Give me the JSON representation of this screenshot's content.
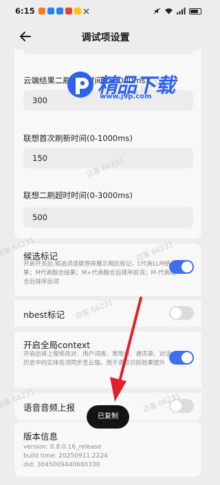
{
  "status_bar": {
    "time": "6:15",
    "battery": "75"
  },
  "nav": {
    "title": "调试项设置"
  },
  "fields": [
    {
      "label": "云端结果二刷超时时间(0-3000ms)",
      "value": "300"
    },
    {
      "label": "联想首次刷新时间(0-1000ms)",
      "value": "150"
    },
    {
      "label": "联想二刷超时时间(0-3000ms)",
      "value": "500"
    }
  ],
  "toggles": [
    {
      "title": "候选标记",
      "desc": "开启开关后,候选词语联想将展示相应标记，L代表LLM结果；M代表融合结果；M+代表融合后排序前词；M-代表融合后排序后词",
      "on": true
    },
    {
      "title": "nbest标记",
      "desc": "",
      "on": false
    },
    {
      "title": "开启全局context",
      "desc": "开启后将上报修改对、用户词库、常用语、通讯录、对话历史中的实体名词同步至云端，用于语音识别效果提升",
      "on": true
    },
    {
      "title": "语音音频上报",
      "desc": "",
      "on": false
    }
  ],
  "version_info": {
    "title": "版本信息",
    "version": "version: 0.8.0.16_release",
    "build_time": "build time: 20250911.2224",
    "did": "did: 3045009440680330"
  },
  "toast": {
    "text": "已复制"
  },
  "watermark": {
    "title": "精品下载",
    "url": "www.j9p.com",
    "mark": "迈客 66231"
  },
  "colors": {
    "accent": "#3f6ef0",
    "background": "#ededed",
    "card": "#f8f8f8",
    "arrow": "#e2202a"
  }
}
